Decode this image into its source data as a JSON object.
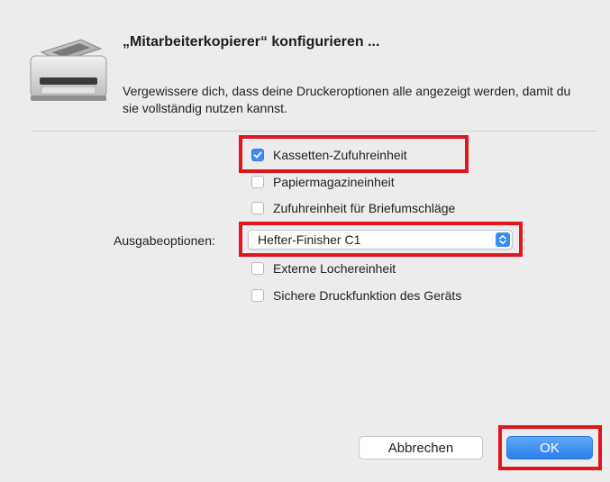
{
  "dialog": {
    "title": "„Mitarbeiterkopierer“ konfigurieren ...",
    "description": "Vergewissere dich, dass deine Druckeroptionen alle angezeigt werden, damit du sie vollständig nutzen kannst."
  },
  "options": [
    {
      "label": "Kassetten-Zufuhreinheit",
      "checked": true
    },
    {
      "label": "Papiermagazineinheit",
      "checked": false
    },
    {
      "label": "Zufuhreinheit für Briefumschläge",
      "checked": false
    },
    {
      "label": "Externe Lochereinheit",
      "checked": false
    },
    {
      "label": "Sichere Druckfunktion des Geräts",
      "checked": false
    }
  ],
  "output": {
    "label": "Ausgabeoptionen:",
    "selected": "Hefter-Finisher C1"
  },
  "buttons": {
    "cancel": "Abbrechen",
    "ok": "OK"
  },
  "colors": {
    "accent": "#3b8df6",
    "highlight": "#e1161b",
    "background": "#ececec"
  },
  "icons": [
    "printer-icon",
    "checkmark-icon",
    "updown-arrows-icon"
  ]
}
